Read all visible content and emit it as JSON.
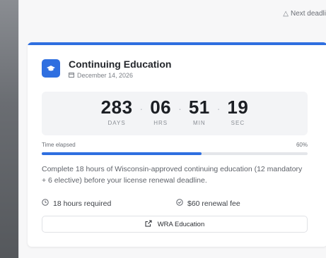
{
  "topbar": {
    "next_deadline_text": "Next deadli"
  },
  "card": {
    "title": "Continuing Education",
    "date": "December 14, 2026",
    "countdown": [
      {
        "value": "283",
        "label": "DAYS"
      },
      {
        "value": "06",
        "label": "HRS"
      },
      {
        "value": "51",
        "label": "MIN"
      },
      {
        "value": "19",
        "label": "SEC"
      }
    ],
    "progress": {
      "label": "Time elapsed",
      "percent_text": "60%",
      "fraction": 0.6
    },
    "description": "Complete 18 hours of Wisconsin-approved continuing education (12 mandatory + 6 elective) before your license renewal deadline.",
    "hours_required": "18 hours required",
    "renewal_fee": "$60 renewal fee",
    "link_label": "WRA Education"
  },
  "colors": {
    "accent": "#2f6fe0"
  }
}
